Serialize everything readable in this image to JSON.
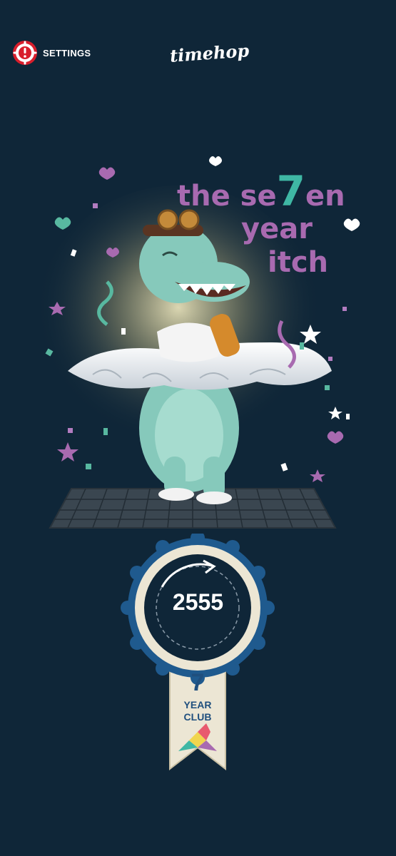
{
  "header": {
    "settings_label": "SETTINGS",
    "settings_icon": "alert-gear-icon",
    "logo_text": "timehop"
  },
  "hero": {
    "title_line1_a": "the se",
    "title_digit": "7",
    "title_line1_b": "en",
    "title_line2": "year",
    "title_line3": "itch"
  },
  "badge": {
    "count": "2555",
    "club_number": "7",
    "club_word1": "YEAR",
    "club_word2": "CLUB"
  },
  "colors": {
    "background": "#0f2638",
    "accent_purple": "#a86ab0",
    "accent_teal": "#3fb7a4",
    "badge_blue": "#1f5a8e",
    "alert_red": "#d81e2c"
  }
}
